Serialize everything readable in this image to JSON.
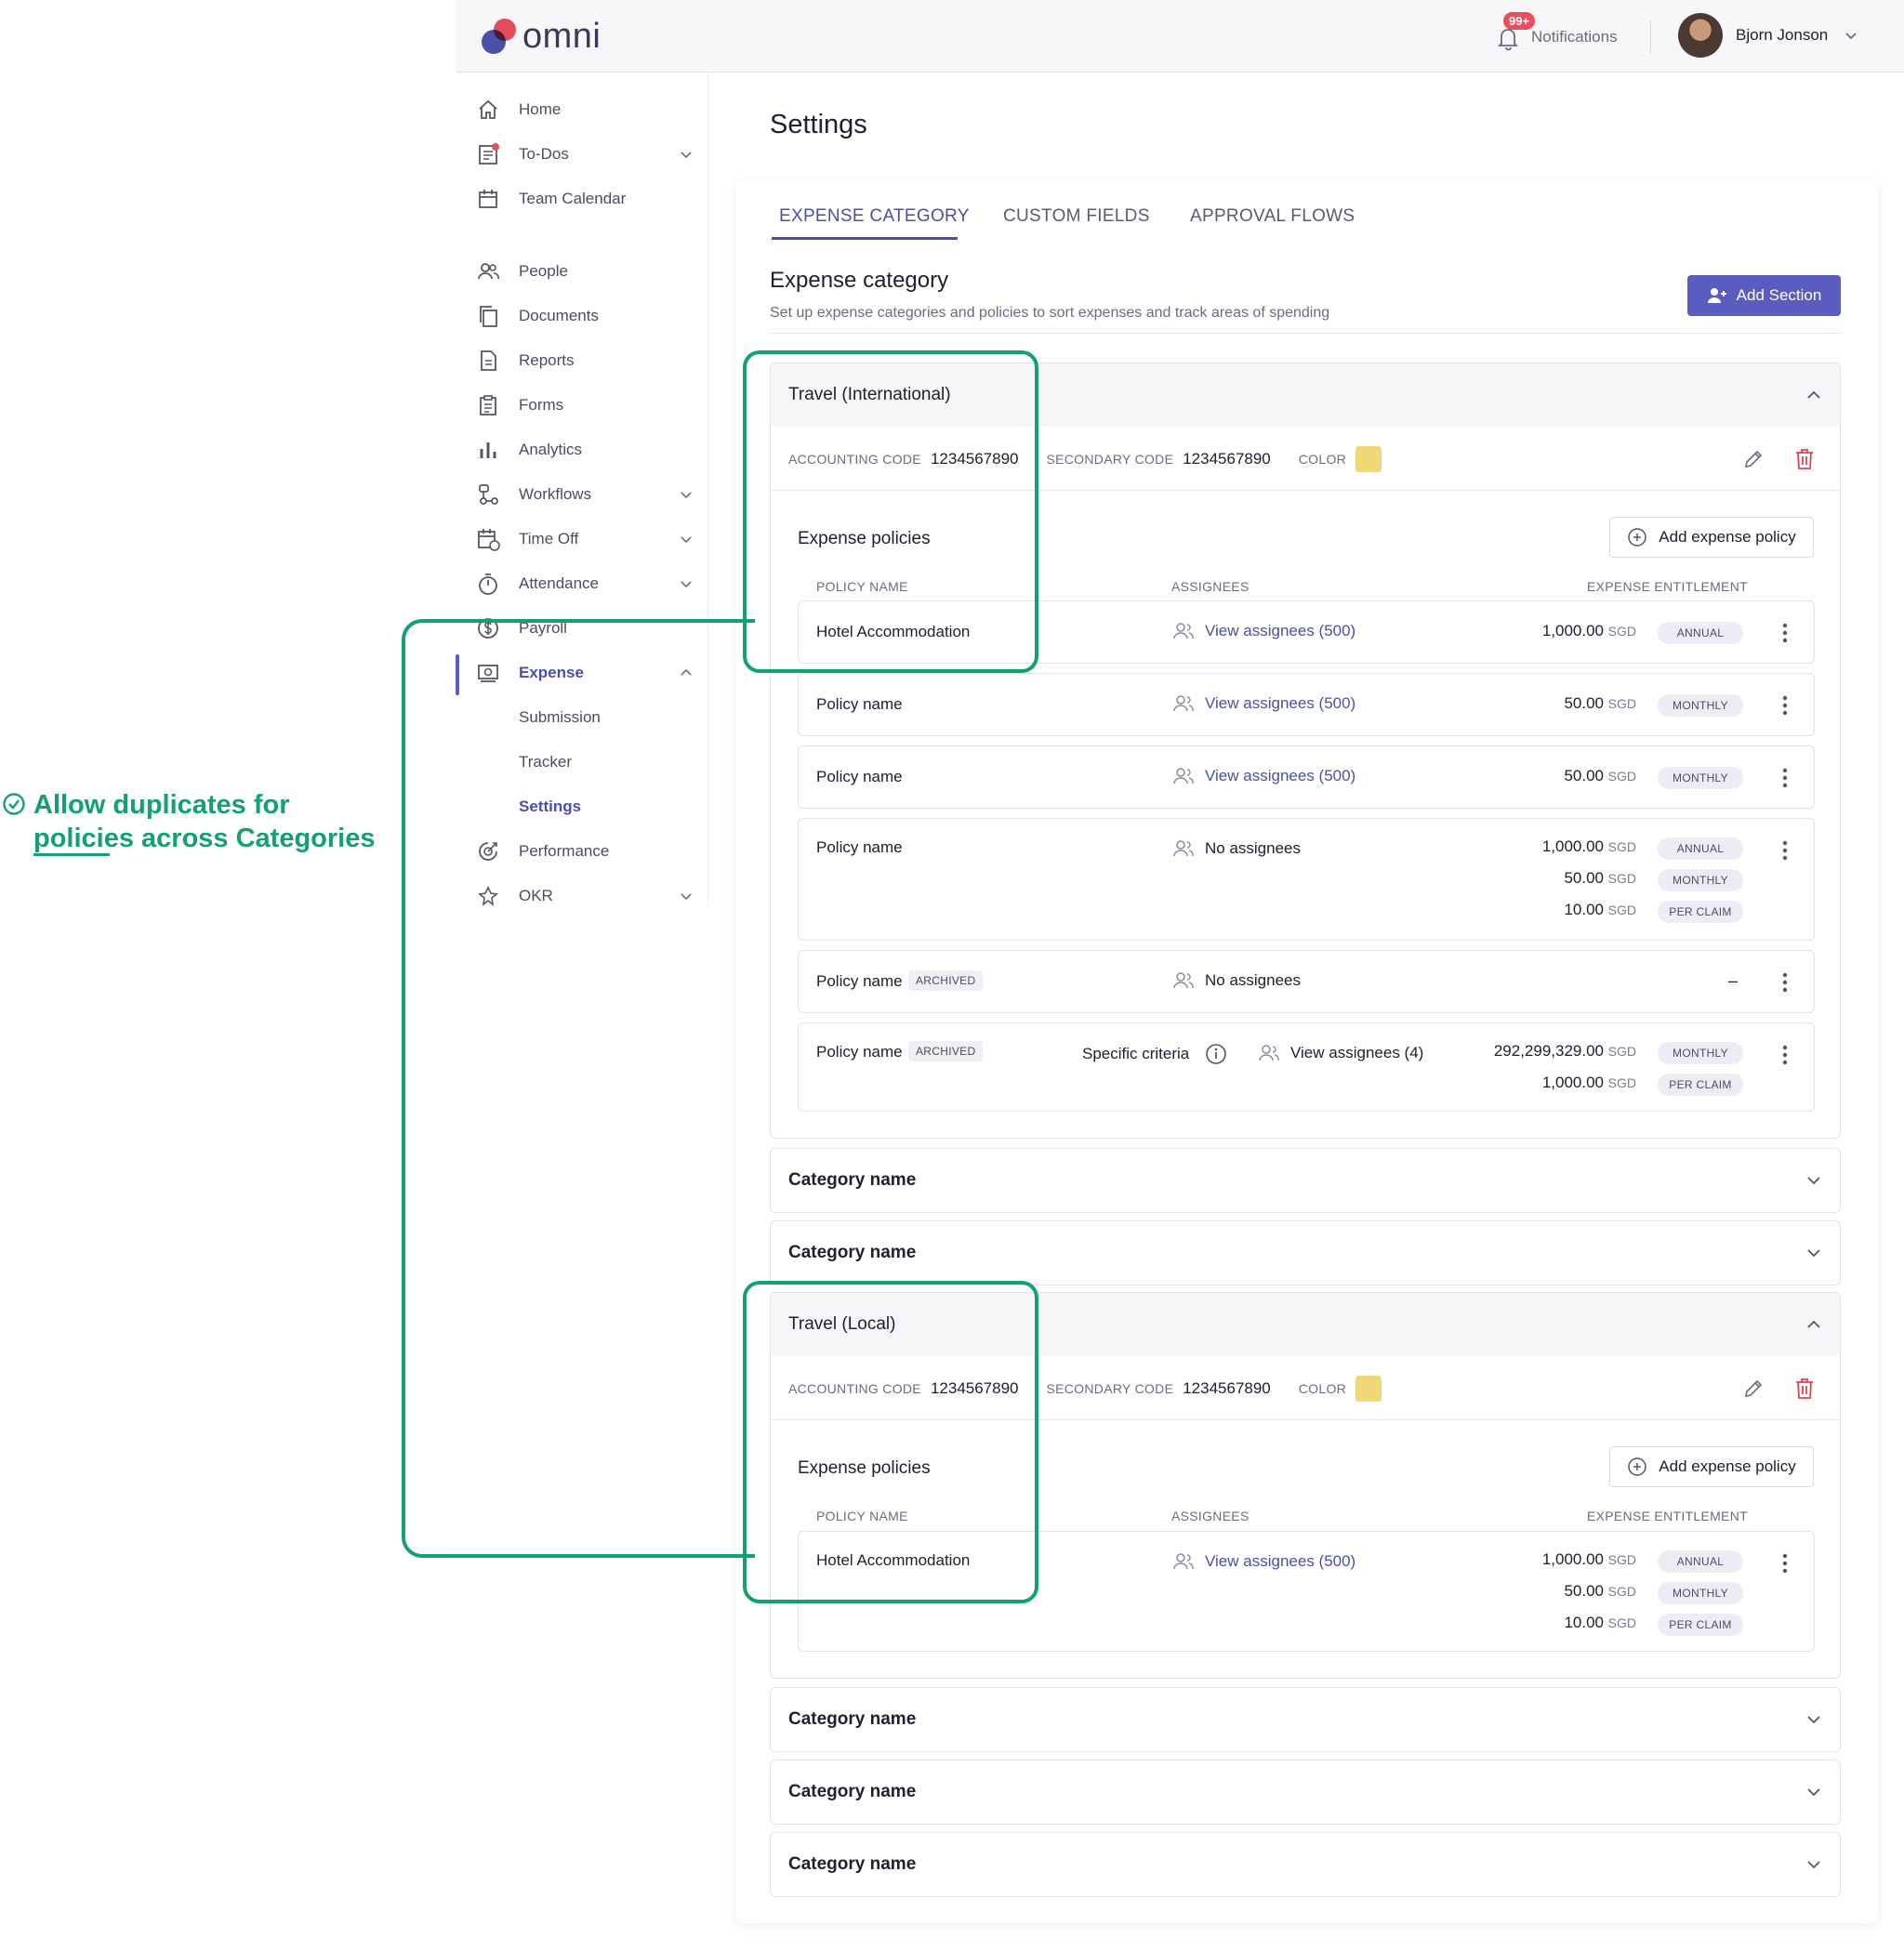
{
  "app": {
    "brand": "omni"
  },
  "topbar": {
    "notifications_badge": "99+",
    "notifications_label": "Notifications",
    "user_name": "Bjorn Jonson"
  },
  "sidebar": {
    "items": [
      {
        "label": "Home",
        "icon": "home-icon"
      },
      {
        "label": "To-Dos",
        "icon": "todo-list-icon"
      },
      {
        "label": "Team Calendar",
        "icon": "calendar-icon"
      },
      {
        "label": "People",
        "icon": "people-icon"
      },
      {
        "label": "Documents",
        "icon": "documents-icon"
      },
      {
        "label": "Reports",
        "icon": "report-icon"
      },
      {
        "label": "Forms",
        "icon": "forms-icon"
      },
      {
        "label": "Analytics",
        "icon": "bar-chart-icon"
      },
      {
        "label": "Workflows",
        "icon": "workflow-icon"
      },
      {
        "label": "Time Off",
        "icon": "time-off-icon"
      },
      {
        "label": "Attendance",
        "icon": "stopwatch-icon"
      },
      {
        "label": "Payroll",
        "icon": "dollar-icon"
      },
      {
        "label": "Expense",
        "icon": "cash-icon"
      },
      {
        "label": "Performance",
        "icon": "target-icon"
      },
      {
        "label": "OKR",
        "icon": "okr-icon"
      }
    ],
    "expense_sub": [
      "Submission",
      "Tracker",
      "Settings"
    ]
  },
  "page": {
    "title": "Settings",
    "tabs": [
      "EXPENSE CATEGORY",
      "CUSTOM FIELDS",
      "APPROVAL FLOWS"
    ],
    "section_title": "Expense category",
    "section_desc": "Set up expense categories and policies to sort expenses and track areas of spending",
    "add_section": "Add Section"
  },
  "labels": {
    "accounting_code": "ACCOUNTING CODE",
    "secondary_code": "SECONDARY CODE",
    "color": "COLOR",
    "expense_policies": "Expense policies",
    "add_expense_policy": "Add expense policy",
    "col_policy": "POLICY NAME",
    "col_assignees": "ASSIGNEES",
    "col_entitlement": "EXPENSE ENTITLEMENT",
    "archived": "ARCHIVED",
    "dash": "–"
  },
  "categories": [
    {
      "name": "Travel (International)",
      "accounting_code": "1234567890",
      "secondary_code": "1234567890",
      "color": "#eed878",
      "policies": [
        {
          "name": "Hotel Accommodation",
          "assignees": "View assignees (500)",
          "entitlements": [
            {
              "amount": "1,000.00",
              "currency": "SGD",
              "period": "ANNUAL"
            }
          ]
        },
        {
          "name": "Policy name",
          "assignees": "View assignees (500)",
          "entitlements": [
            {
              "amount": "50.00",
              "currency": "SGD",
              "period": "MONTHLY"
            }
          ]
        },
        {
          "name": "Policy name",
          "assignees": "View assignees (500)",
          "entitlements": [
            {
              "amount": "50.00",
              "currency": "SGD",
              "period": "MONTHLY"
            }
          ]
        },
        {
          "name": "Policy name",
          "assignees": "No assignees",
          "entitlements": [
            {
              "amount": "1,000.00",
              "currency": "SGD",
              "period": "ANNUAL"
            },
            {
              "amount": "50.00",
              "currency": "SGD",
              "period": "MONTHLY"
            },
            {
              "amount": "10.00",
              "currency": "SGD",
              "period": "PER CLAIM"
            }
          ]
        },
        {
          "name": "Policy name",
          "archived": true,
          "assignees": "No assignees",
          "entitlements": []
        },
        {
          "name": "Policy name",
          "archived": true,
          "criteria": "Specific criteria",
          "assignees": "View assignees (4)",
          "entitlements": [
            {
              "amount": "292,299,329.00",
              "currency": "SGD",
              "period": "MONTHLY"
            },
            {
              "amount": "1,000.00",
              "currency": "SGD",
              "period": "PER CLAIM"
            }
          ]
        }
      ]
    },
    {
      "name": "Category name"
    },
    {
      "name": "Category name"
    },
    {
      "name": "Travel (Local)",
      "accounting_code": "1234567890",
      "secondary_code": "1234567890",
      "color": "#eed878",
      "policies": [
        {
          "name": "Hotel Accommodation",
          "assignees": "View assignees (500)",
          "entitlements": [
            {
              "amount": "1,000.00",
              "currency": "SGD",
              "period": "ANNUAL"
            },
            {
              "amount": "50.00",
              "currency": "SGD",
              "period": "MONTHLY"
            },
            {
              "amount": "10.00",
              "currency": "SGD",
              "period": "PER CLAIM"
            }
          ]
        }
      ]
    },
    {
      "name": "Category name"
    },
    {
      "name": "Category name"
    },
    {
      "name": "Category name"
    }
  ],
  "annotation": {
    "text": "Allow duplicates for policies across Categories",
    "color": "#14a06f"
  }
}
